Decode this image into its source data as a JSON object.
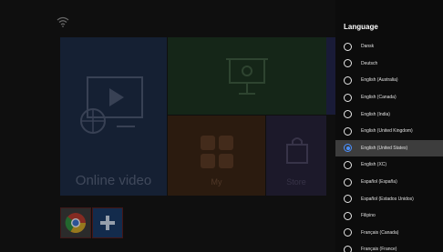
{
  "launcher": {
    "wifi_icon": "wifi-icon",
    "tiles": {
      "video_label": "Online video",
      "orange_label": "My",
      "purple_label": "Store"
    }
  },
  "language_panel": {
    "title": "Language",
    "items": [
      {
        "label": "Dansk",
        "selected": false
      },
      {
        "label": "Deutsch",
        "selected": false
      },
      {
        "label": "English (Australia)",
        "selected": false
      },
      {
        "label": "English (Canada)",
        "selected": false
      },
      {
        "label": "English (India)",
        "selected": false
      },
      {
        "label": "English (United Kingdom)",
        "selected": false
      },
      {
        "label": "English (United States)",
        "selected": true
      },
      {
        "label": "English (XC)",
        "selected": false
      },
      {
        "label": "Español (España)",
        "selected": false
      },
      {
        "label": "Español (Estados Unidos)",
        "selected": false
      },
      {
        "label": "Filipino",
        "selected": false
      },
      {
        "label": "Français (Canada)",
        "selected": false
      },
      {
        "label": "Français (France)",
        "selected": false
      }
    ]
  },
  "colors": {
    "accent": "#4a90ff",
    "panel_bg": "#0c0c0c",
    "selected_bg": "#3d3d3d"
  }
}
